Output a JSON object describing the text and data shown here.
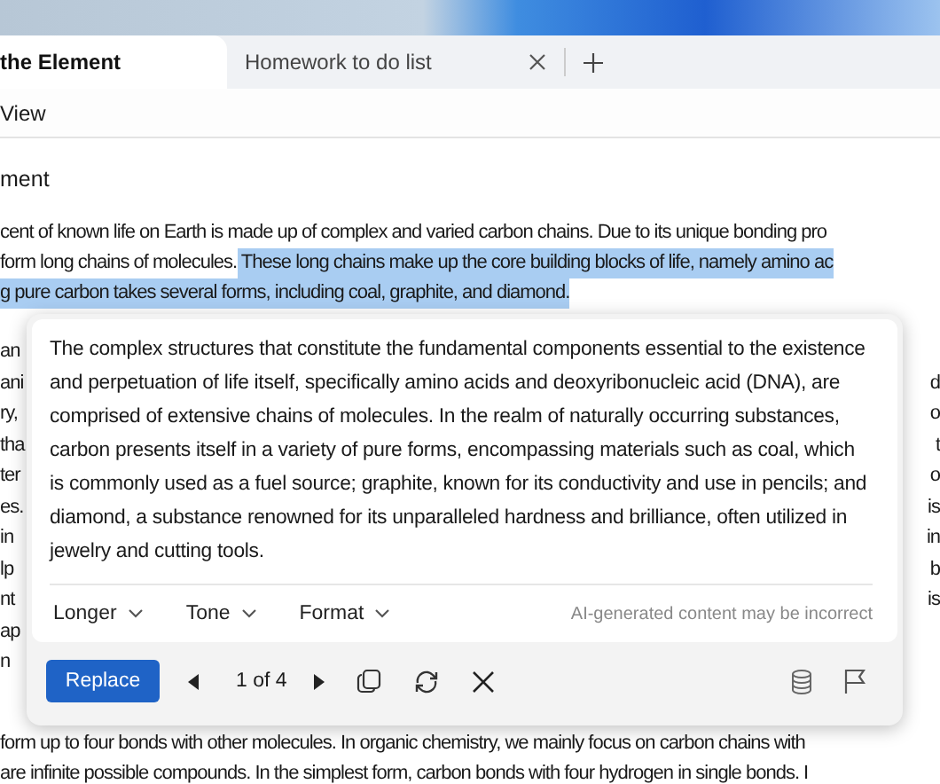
{
  "tabs": [
    {
      "label": "the Element",
      "selected": true,
      "closable": false
    },
    {
      "label": "Homework to do list",
      "selected": false,
      "closable": true
    }
  ],
  "menu": [
    "View"
  ],
  "document": {
    "heading": "ment",
    "lines": [
      [
        {
          "text": "cent of known life on Earth is made up of complex and varied carbon chains. Due to its unique bonding pro",
          "selected": false
        }
      ],
      [
        {
          "text": "form long chains of molecules.",
          "selected": false
        },
        {
          "text": " These long chains make up the core building blocks of life, namely amino ac",
          "selected": true
        }
      ],
      [
        {
          "text": "g pure carbon takes several forms, including coal, graphite, and diamond.",
          "selected": true
        }
      ]
    ],
    "covered_lines": [
      {
        "left": "an"
      },
      {
        "left": "ani",
        "right": "d"
      },
      {
        "left": "ry,",
        "right": "o"
      },
      {
        "left": "tha",
        "right": "t"
      },
      {
        "left": "ter",
        "right": "o"
      },
      {
        "left": "es.",
        "right": "is"
      },
      {
        "left": "in",
        "right": "in"
      },
      {
        "left": "lp",
        "right": "b"
      },
      {
        "left": "nt",
        "right": "is"
      },
      {
        "left": "ap"
      },
      {
        "left": "n"
      }
    ],
    "lines_after": [
      "form up to four bonds with other molecules. In organic chemistry, we mainly focus on carbon chains with",
      "are infinite possible compounds. In the simplest form, carbon bonds with four hydrogen in single bonds. I"
    ]
  },
  "rewrite_popup": {
    "text": "The complex structures that constitute the fundamental components essential to the existence and perpetuation of life itself, specifically amino acids and deoxyribonucleic acid (DNA), are comprised of extensive chains of molecules. In the realm of naturally occurring substances, carbon presents itself in a variety of pure forms, encompassing materials such as coal, which is commonly used as a fuel source; graphite, known for its conductivity and use in pencils; and diamond, a substance renowned for its unparalleled hardness and brilliance, often utilized in jewelry and cutting tools.",
    "options": [
      "Longer",
      "Tone",
      "Format"
    ],
    "disclaimer": "AI-generated content may be incorrect",
    "replace_button": "Replace",
    "pager": "1 of 4"
  }
}
